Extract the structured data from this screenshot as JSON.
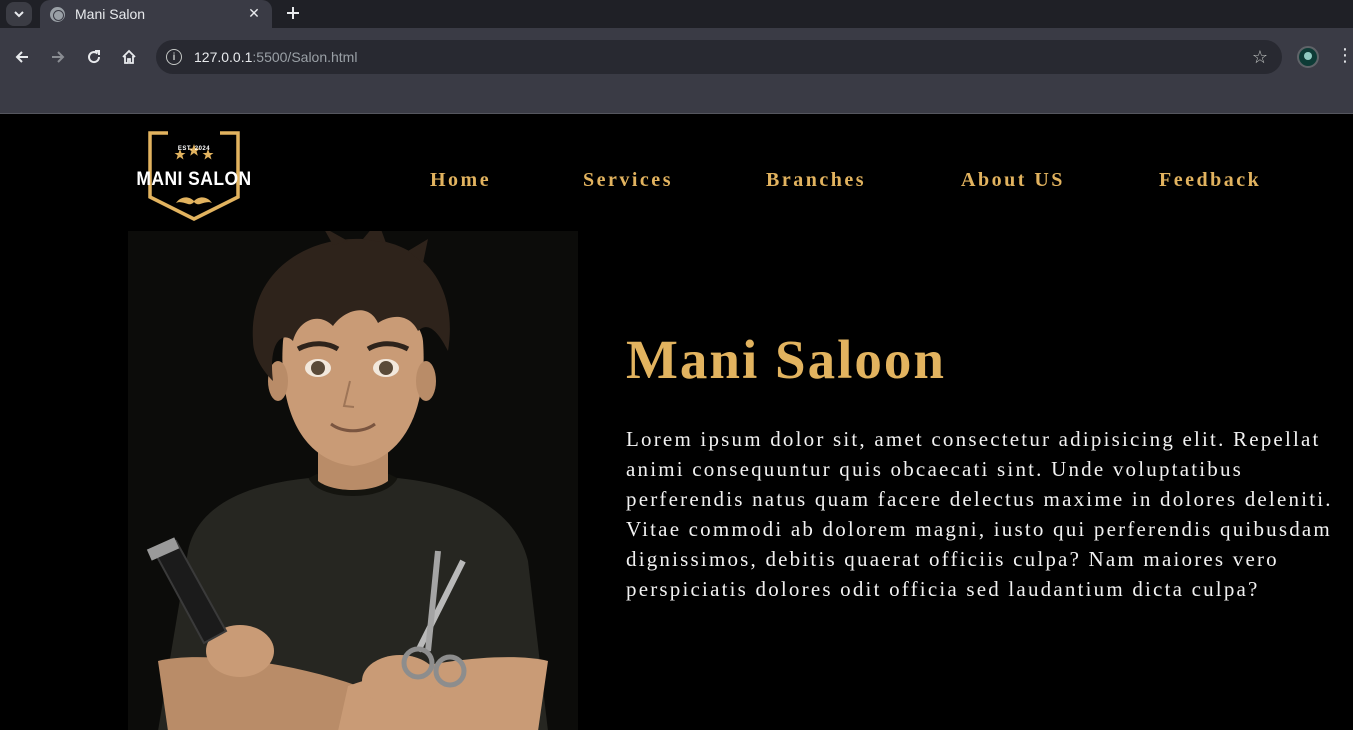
{
  "browser": {
    "tab_title": "Mani Salon",
    "url_host": "127.0.0.1",
    "url_path": ":5500/Salon.html",
    "icons": [
      "tab-search-icon",
      "globe-icon",
      "close-icon",
      "plus-icon",
      "back-icon",
      "forward-icon",
      "reload-icon",
      "home-icon",
      "info-icon",
      "star-icon",
      "profile-icon",
      "more-vert-icon"
    ]
  },
  "logo": {
    "est": "EST. 2024",
    "name": "MANI SALON"
  },
  "nav": {
    "items": [
      {
        "label": "Home"
      },
      {
        "label": "Services"
      },
      {
        "label": "Branches"
      },
      {
        "label": "About US"
      },
      {
        "label": "Feedback"
      }
    ]
  },
  "hero": {
    "title": "Mani Saloon",
    "text": "Lorem ipsum dolor sit, amet consectetur adipisicing elit. Repellat animi consequuntur quis obcaecati sint. Unde voluptatibus perferendis natus quam facere delectus maxime in dolores deleniti. Vitae commodi ab dolorem magni, iusto qui perferendis quibusdam dignissimos, debitis quaerat officiis culpa? Nam maiores vero perspiciatis dolores odit officia sed laudantium dicta culpa?"
  },
  "colors": {
    "gold": "#e2b35f",
    "background": "#000000",
    "text": "#f2f2f2"
  }
}
